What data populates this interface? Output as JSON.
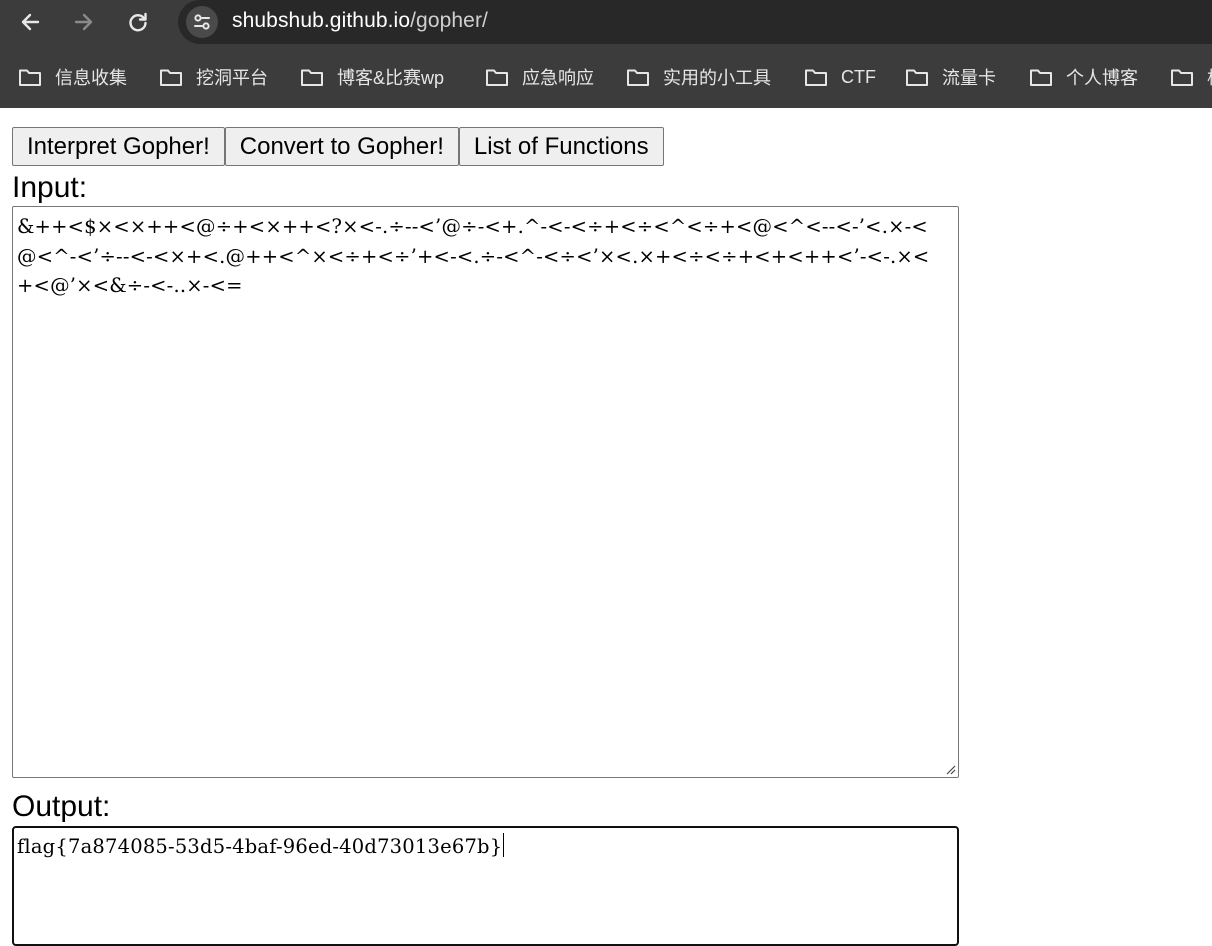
{
  "browser": {
    "url_host": "shubshub.github.io",
    "url_path": "/gopher/",
    "bookmarks": [
      {
        "label": "信息收集"
      },
      {
        "label": "挖洞平台"
      },
      {
        "label": "博客&比赛wp"
      },
      {
        "label": "应急响应"
      },
      {
        "label": "实用的小工具"
      },
      {
        "label": "CTF"
      },
      {
        "label": "流量卡"
      },
      {
        "label": "个人博客"
      },
      {
        "label": "杭"
      }
    ]
  },
  "page": {
    "buttons": {
      "interpret": "Interpret Gopher!",
      "convert": "Convert to Gopher!",
      "functions": "List of Functions"
    },
    "input_label": "Input:",
    "output_label": "Output:",
    "input_value": "&++<$×<×++<@÷+<×++<?×<-.÷--<’@÷-<+.^-<-<÷+<÷<^<÷+<@<^<--<-’<.×-<@<^-<’÷--<-<×+<.@++<^×<÷+<÷’+<-<.÷-<^-<÷<’×<.×+<÷<÷+<+<++<’-<-.×<+<@’×<&÷-<-..×-<=",
    "output_value": "flag{7a874085-53d5-4baf-96ed-40d73013e67b}"
  }
}
